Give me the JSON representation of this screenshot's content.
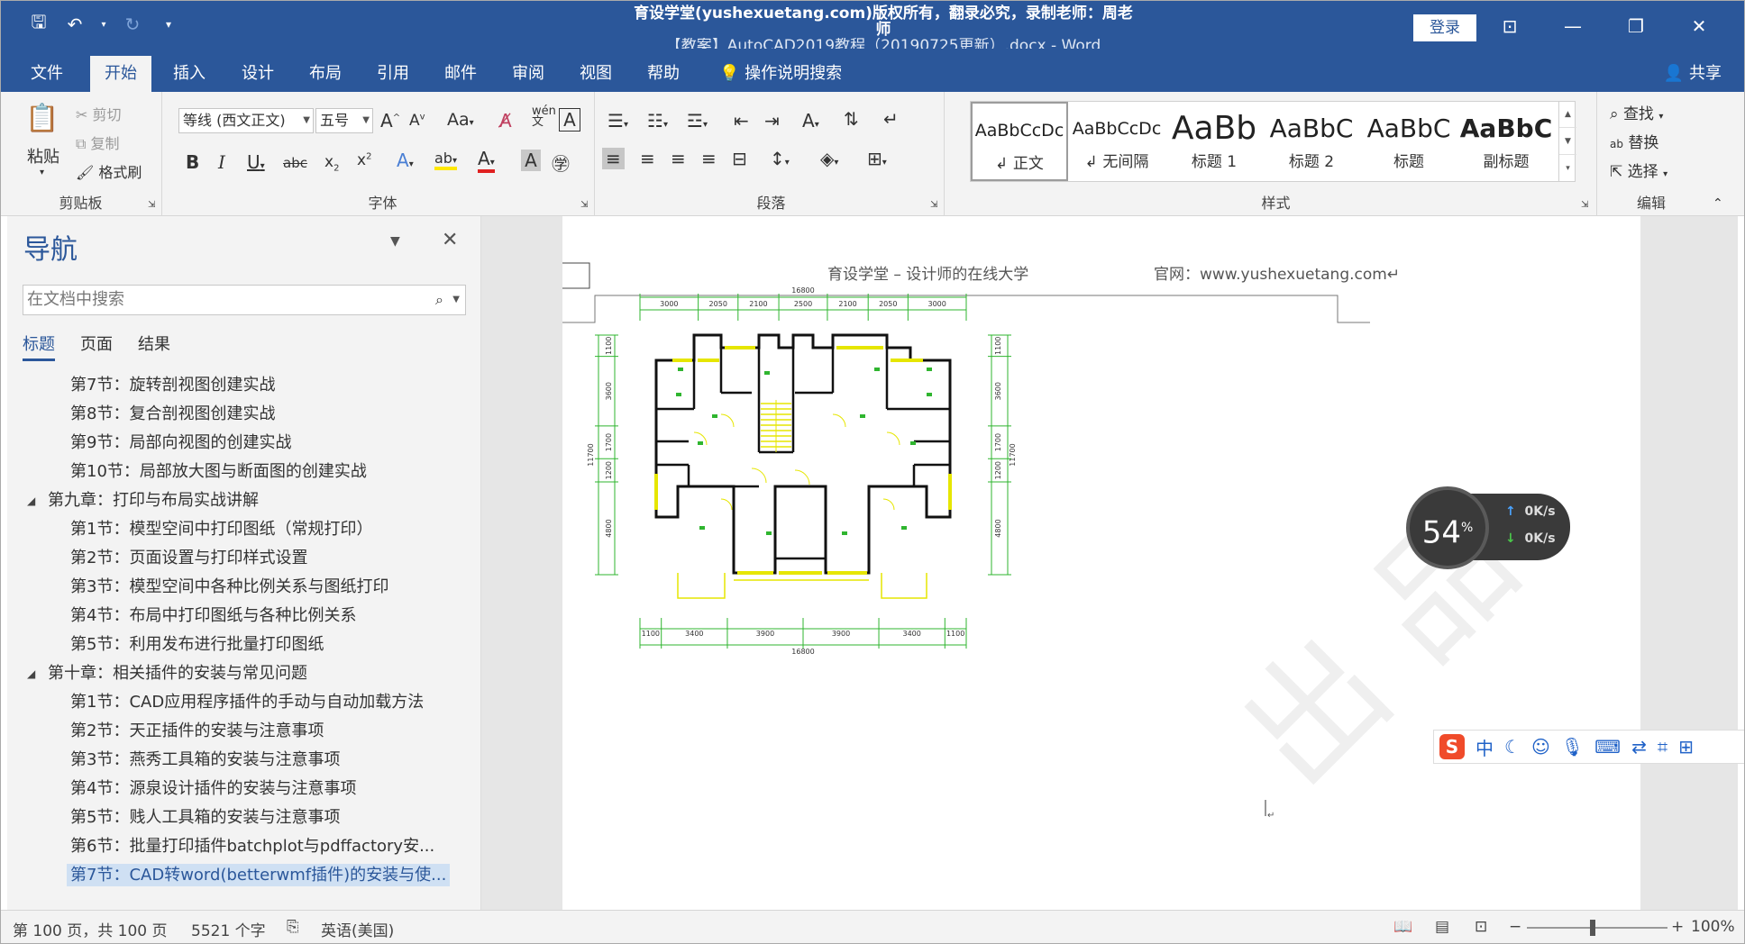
{
  "titlebar": {
    "watermark": "育设学堂(yushexuetang.com)版权所有，翻录必究，录制老师：周老师",
    "doc_title": "【教案】AutoCAD2019教程（20190725更新）.docx - Word",
    "login": "登录"
  },
  "tabs": [
    "文件",
    "开始",
    "插入",
    "设计",
    "布局",
    "引用",
    "邮件",
    "审阅",
    "视图",
    "帮助"
  ],
  "active_tab": "开始",
  "tell_me": "操作说明搜索",
  "share": "共享",
  "ribbon": {
    "clipboard": {
      "paste": "粘贴",
      "cut": "剪切",
      "copy": "复制",
      "format_painter": "格式刷",
      "label": "剪贴板"
    },
    "font": {
      "name": "等线 (西文正文)",
      "size": "五号",
      "label": "字体",
      "change_case": "Aa"
    },
    "paragraph": {
      "label": "段落"
    },
    "styles": {
      "label": "样式",
      "items": [
        {
          "sample": "AaBbCcDc",
          "name": "正文"
        },
        {
          "sample": "AaBbCcDc",
          "name": "无间隔"
        },
        {
          "sample": "AaBb",
          "name": "标题 1"
        },
        {
          "sample": "AaBbC",
          "name": "标题 2"
        },
        {
          "sample": "AaBbC",
          "name": "标题"
        },
        {
          "sample": "AaBbC",
          "name": "副标题"
        }
      ]
    },
    "editing": {
      "find": "查找",
      "replace": "替换",
      "select": "选择",
      "label": "编辑"
    }
  },
  "nav": {
    "title": "导航",
    "search_placeholder": "在文档中搜索",
    "tabs": [
      "标题",
      "页面",
      "结果"
    ],
    "items": [
      {
        "level": 2,
        "text": "第7节：旋转剖视图创建实战"
      },
      {
        "level": 2,
        "text": "第8节：复合剖视图创建实战"
      },
      {
        "level": 2,
        "text": "第9节：局部向视图的创建实战"
      },
      {
        "level": 2,
        "text": "第10节：局部放大图与断面图的创建实战"
      },
      {
        "level": 1,
        "text": "第九章：打印与布局实战讲解"
      },
      {
        "level": 2,
        "text": "第1节：模型空间中打印图纸（常规打印）"
      },
      {
        "level": 2,
        "text": "第2节：页面设置与打印样式设置"
      },
      {
        "level": 2,
        "text": "第3节：模型空间中各种比例关系与图纸打印"
      },
      {
        "level": 2,
        "text": "第4节：布局中打印图纸与各种比例关系"
      },
      {
        "level": 2,
        "text": "第5节：利用发布进行批量打印图纸"
      },
      {
        "level": 1,
        "text": "第十章：相关插件的安装与常见问题"
      },
      {
        "level": 2,
        "text": "第1节：CAD应用程序插件的手动与自动加载方法"
      },
      {
        "level": 2,
        "text": "第2节：天正插件的安装与注意事项"
      },
      {
        "level": 2,
        "text": "第3节：燕秀工具箱的安装与注意事项"
      },
      {
        "level": 2,
        "text": "第4节：源泉设计插件的安装与注意事项"
      },
      {
        "level": 2,
        "text": "第5节：贱人工具箱的安装与注意事项"
      },
      {
        "level": 2,
        "text": "第6节：批量打印插件batchplot与pdffactory安..."
      },
      {
        "level": 2,
        "text": "第7节：CAD转word(betterwmf插件)的安装与使...",
        "selected": true
      }
    ]
  },
  "document": {
    "header_left": "育设学堂 – 设计师的在线大学",
    "header_right": "官网：www.yushexuetang.com↵",
    "dims_top": [
      "3000",
      "2050",
      "2100",
      "2500",
      "2100",
      "2050",
      "3000"
    ],
    "dims_top_total": "16800",
    "dims_bottom": [
      "1100",
      "3400",
      "3900",
      "3900",
      "3400",
      "1100"
    ],
    "dims_bottom_total": "16800",
    "dims_left": [
      "1100",
      "3600",
      "1700",
      "1200",
      "4800"
    ],
    "dims_left_total": "11700"
  },
  "speed_widget": {
    "percent": "54",
    "up": "0K/s",
    "down": "0K/s"
  },
  "ime": {
    "mode": "中"
  },
  "status": {
    "page": "第 100 页，共 100 页",
    "words": "5521 个字",
    "language": "英语(美国)",
    "zoom": "100%"
  },
  "colors": {
    "accent": "#2b579a",
    "cad_green": "#2fb52f",
    "cad_yellow": "#e6e600"
  }
}
